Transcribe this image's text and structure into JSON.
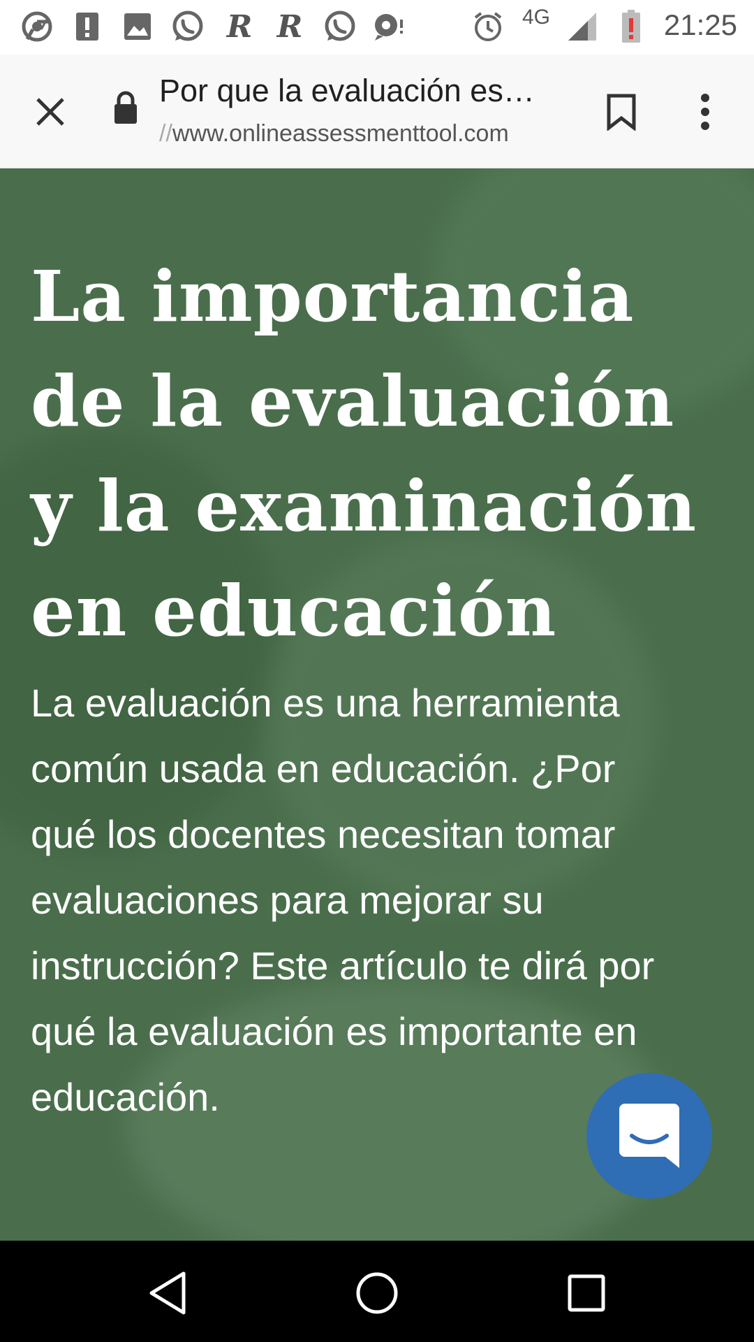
{
  "status_bar": {
    "notification_icons": [
      "chrome-icon",
      "alert-icon",
      "image-icon",
      "whatsapp-icon",
      "r-app-icon",
      "r-app-icon",
      "whatsapp-icon",
      "chat-bubble-icon"
    ],
    "r_glyph": "R",
    "network": "4G",
    "time": "21:25"
  },
  "browser": {
    "page_title": "Por que la evaluación es…",
    "url_scheme": "//",
    "url_host": "www.onlineassessmenttool.com"
  },
  "article": {
    "heading": "La importancia de la evaluación y la examinación en educación",
    "intro": "La evaluación es una herramienta común usada en educación. ¿Por qué los docentes necesitan tomar evaluaciones para mejorar su instrucción? Este artículo te dirá por qué la evaluación es importante en educación."
  },
  "colors": {
    "hero_green": "#4a6e4c",
    "chat_blue": "#2f6db4",
    "battery_alert": "#e53935"
  }
}
